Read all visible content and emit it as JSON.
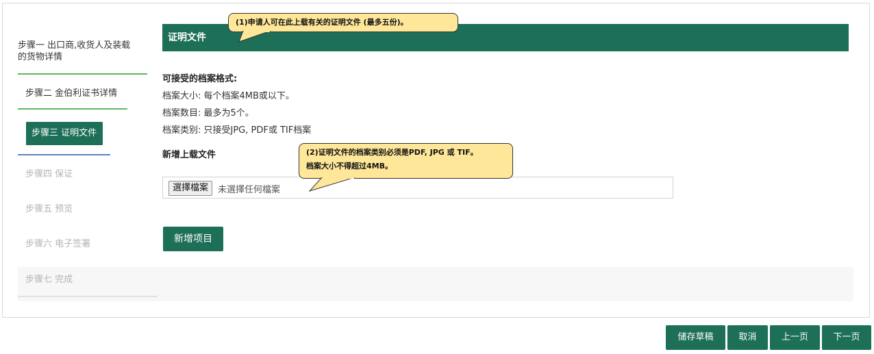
{
  "steps": [
    {
      "label": "步骤一 出口商,收货人及装载的货物详情",
      "status": "done"
    },
    {
      "label": "步骤二 金伯利证书详情",
      "status": "done"
    },
    {
      "label": "步骤三 证明文件",
      "status": "active"
    },
    {
      "label": "步骤四 保证",
      "status": "pending"
    },
    {
      "label": "步骤五 预览",
      "status": "pending"
    },
    {
      "label": "步骤六 电子签署",
      "status": "pending"
    },
    {
      "label": "步骤七 完成",
      "status": "pending"
    }
  ],
  "section": {
    "title": "证明文件"
  },
  "formats": {
    "heading": "可接受的档案格式:",
    "size": "档案大小: 每个档案4MB或以下。",
    "count": "档案数目: 最多为5个。",
    "type": "档案类别: 只接受JPG, PDF或 TIF档案"
  },
  "upload": {
    "heading": "新增上载文件",
    "choose_button": "選擇檔案",
    "no_file": "未選擇任何檔案",
    "add_item_button": "新增项目"
  },
  "tooltips": {
    "tip1": "(1)申请人可在此上载有关的证明文件 (最多五份)。",
    "tip2_line1": "(2)证明文件的档案类别必须是PDF, JPG 或 TIF。",
    "tip2_line2": "档案大小不得超过4MB。"
  },
  "footer": {
    "save_draft": "储存草稿",
    "cancel": "取消",
    "prev": "上一页",
    "next": "下一页"
  },
  "colors": {
    "accent": "#1d6f58",
    "tooltip": "#ffe79a"
  }
}
